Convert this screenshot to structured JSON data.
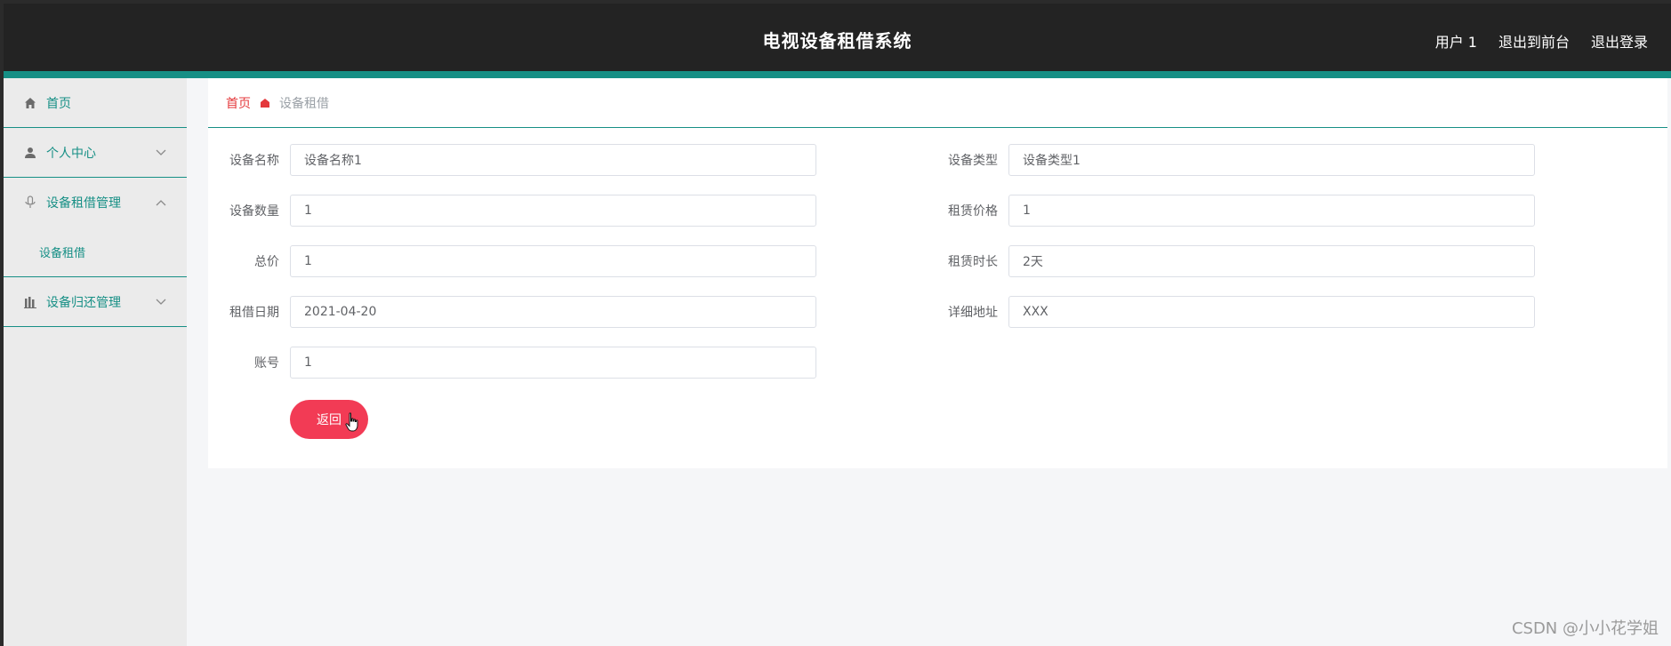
{
  "header": {
    "title": "电视设备租借系统",
    "links": [
      "用户 1",
      "退出到前台",
      "退出登录"
    ]
  },
  "sidebar": {
    "items": [
      {
        "label": "首页",
        "icon": "home-icon"
      },
      {
        "label": "个人中心",
        "icon": "user-icon",
        "chevron": "down"
      },
      {
        "label": "设备租借管理",
        "icon": "microphone-icon",
        "chevron": "up"
      },
      {
        "label": "设备租借",
        "sub": true
      },
      {
        "label": "设备归还管理",
        "icon": "bar-chart-icon",
        "chevron": "down"
      }
    ]
  },
  "breadcrumb": {
    "home": "首页",
    "current": "设备租借"
  },
  "form": {
    "fields": [
      {
        "label": "设备名称",
        "value": "设备名称1"
      },
      {
        "label": "设备类型",
        "value": "设备类型1"
      },
      {
        "label": "设备数量",
        "value": "1"
      },
      {
        "label": "租赁价格",
        "value": "1"
      },
      {
        "label": "总价",
        "value": "1"
      },
      {
        "label": "租赁时长",
        "value": "2天"
      },
      {
        "label": "租借日期",
        "value": "2021-04-20"
      },
      {
        "label": "详细地址",
        "value": "XXX"
      },
      {
        "label": "账号",
        "value": "1"
      }
    ],
    "back_label": "返回"
  },
  "watermark": "CSDN @小小花学姐",
  "colors": {
    "accent": "#168f85",
    "button": "#f23b55",
    "breadcrumb_home": "#e4393c",
    "header_bg": "#232323"
  }
}
